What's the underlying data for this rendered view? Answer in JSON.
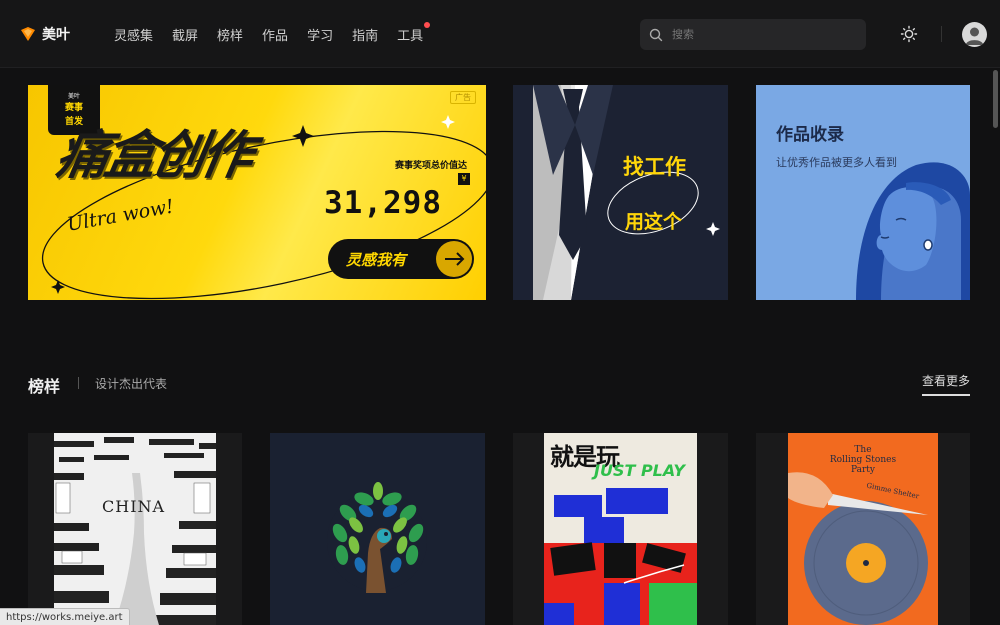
{
  "brand": {
    "name": "美叶"
  },
  "nav": {
    "items": [
      {
        "label": "灵感集"
      },
      {
        "label": "截屏"
      },
      {
        "label": "榜样"
      },
      {
        "label": "作品"
      },
      {
        "label": "学习"
      },
      {
        "label": "指南"
      },
      {
        "label": "工具",
        "has_dot": true
      }
    ]
  },
  "search": {
    "placeholder": "搜索",
    "icon": "search-icon"
  },
  "header_icons": {
    "theme": "sun-icon",
    "user": "avatar"
  },
  "banners": {
    "b1": {
      "badge_top": "美叶",
      "badge_lines": [
        "赛事",
        "首发"
      ],
      "ad_tag": "广告",
      "script_title": "痛盒创作",
      "script_sub": "Ultra wow!",
      "prize_label": "赛事奖项总价值达",
      "currency": "¥",
      "amount": "31,298",
      "cta": "灵感我有"
    },
    "b2": {
      "line1": "找工作",
      "line2": "用这个"
    },
    "b3": {
      "title": "作品收录",
      "subtitle": "让优秀作品被更多人看到"
    }
  },
  "section": {
    "title": "榜样",
    "subtitle": "设计杰出代表",
    "more": "查看更多"
  },
  "cards": {
    "c1": {
      "text": "CHINA"
    },
    "c3": {
      "text1": "就是玩",
      "text2": "JUST PLAY"
    },
    "c4": {
      "line1": "The",
      "line2": "Rolling Stones",
      "line3": "Party",
      "tag": "Gimme Shelter"
    }
  },
  "status_bar": {
    "url": "https://works.meiye.art"
  },
  "colors": {
    "accent": "#ffd60a",
    "background": "#111112",
    "notification": "#ff4d4f"
  }
}
